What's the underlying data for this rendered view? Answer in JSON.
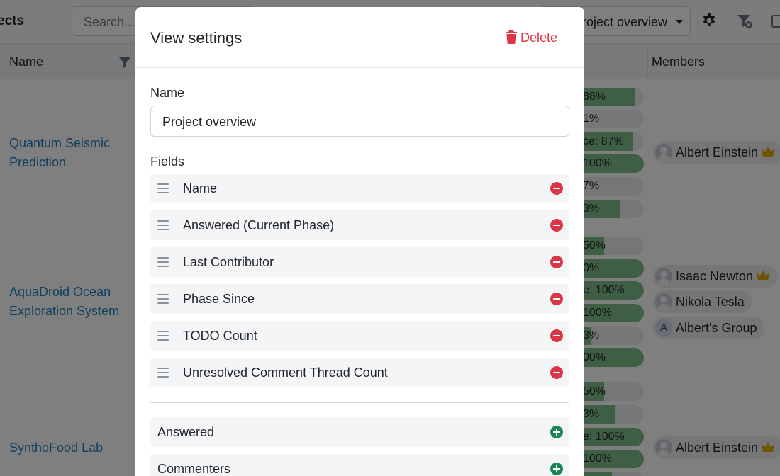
{
  "app": {
    "title": "ects",
    "search_placeholder": "Search...",
    "view_select_value": "Project overview",
    "table": {
      "name_header": "Name",
      "members_header": "Members"
    },
    "rows": [
      {
        "name": "Quantum Seismic Prediction",
        "progress": [
          {
            "text": "88%",
            "fill": 0.88
          },
          {
            "text": "1%",
            "fill": 0.01
          },
          {
            "text": "ce: 87%",
            "fill": 0.87
          },
          {
            "text": "100%",
            "fill": 1.0
          },
          {
            "text": "7%",
            "fill": 0.07
          },
          {
            "text": "3%",
            "fill": 0.7
          }
        ],
        "members": [
          {
            "name": "Albert Einstein",
            "owner": true,
            "type": "user"
          }
        ]
      },
      {
        "name": "AquaDroid Ocean Exploration System",
        "progress": [
          {
            "text": "50%",
            "fill": 0.5
          },
          {
            "text": "0%",
            "fill": 1.0
          },
          {
            "text": "e: 100%",
            "fill": 1.0
          },
          {
            "text": "100%",
            "fill": 1.0
          },
          {
            "text": "3%",
            "fill": 0.33
          },
          {
            "text": "00%",
            "fill": 1.0
          }
        ],
        "members": [
          {
            "name": "Isaac Newton",
            "owner": true,
            "type": "user"
          },
          {
            "name": "Nikola Tesla",
            "owner": false,
            "type": "user"
          },
          {
            "name": "Albert's Group",
            "owner": false,
            "type": "group",
            "initial": "A"
          }
        ]
      },
      {
        "name": "SynthoFood Lab",
        "progress": [
          {
            "text": "50%",
            "fill": 0.5
          },
          {
            "text": "3%",
            "fill": 0.63
          },
          {
            "text": "e: 100%",
            "fill": 1.0
          },
          {
            "text": "100%",
            "fill": 1.0
          },
          {
            "text": "",
            "fill": 0.6
          }
        ],
        "members": [
          {
            "name": "Albert Einstein",
            "owner": true,
            "type": "user"
          }
        ]
      }
    ]
  },
  "modal": {
    "title": "View settings",
    "delete_label": "Delete",
    "name_label": "Name",
    "name_value": "Project overview",
    "fields_label": "Fields",
    "selected_fields": [
      "Name",
      "Answered (Current Phase)",
      "Last Contributor",
      "Phase Since",
      "TODO Count",
      "Unresolved Comment Thread Count"
    ],
    "available_fields": [
      "Answered",
      "Commenters"
    ]
  },
  "colors": {
    "link": "#1f7fc2",
    "danger": "#dc3545",
    "success": "#198754",
    "progress_fill": "#7fbf8a"
  }
}
